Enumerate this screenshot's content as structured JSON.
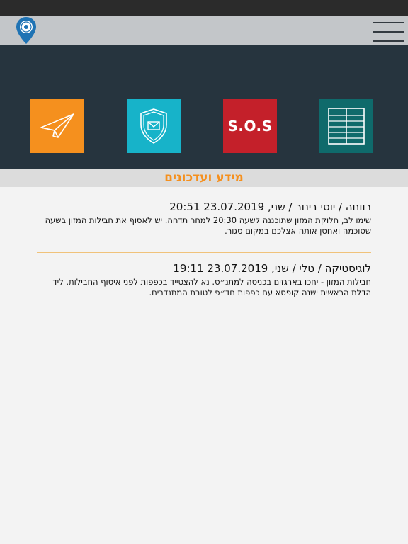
{
  "colors": {
    "accent_orange": "#f5901e",
    "accent_cyan": "#17b3c9",
    "accent_red": "#c4202a",
    "accent_teal": "#0f6a6b",
    "panel_dark": "#26343e",
    "top_bar": "#c3c6c9"
  },
  "header": {
    "logo_icon": "location-pin-logo-icon",
    "menu_icon": "hamburger-menu-icon"
  },
  "tiles": [
    {
      "icon": "paper-plane-icon"
    },
    {
      "icon": "shield-mail-icon"
    },
    {
      "icon": "sos-icon",
      "label": "S.O.S"
    },
    {
      "icon": "notice-board-icon"
    }
  ],
  "section": {
    "title": "מידע ועדכונים"
  },
  "news": [
    {
      "title": "רווחה / יוסי בינור / שני, 23.07.2019 20:51",
      "body": "שימו לב, חלוקת המזון שתוכננה לשעה 20:30 למחר תדחה. יש לאסוף את חבילות המזון בשעה שסוכמה ואחסן אותה אצלכם במקום סגור."
    },
    {
      "title": "לוגיסטיקה / טלי / שני, 23.07.2019 19:11",
      "body": "חבילות המזון - יחכו בארגזים בכניסה למתנ״ס. נא להצטייד בכפפות לפני איסוף החבילות. ליד הדלת הראשית ישנה קופסא עם כפפות חד״פ לטובת המתנדבים."
    }
  ]
}
